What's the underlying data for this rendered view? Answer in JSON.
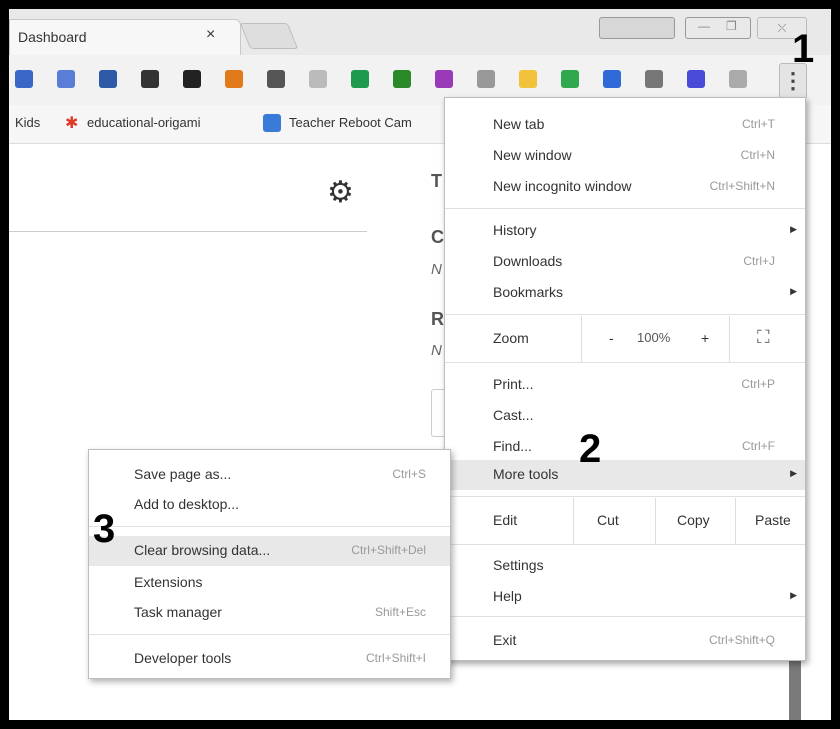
{
  "tab": {
    "title": "Dashboard",
    "close": "×"
  },
  "window": {
    "close": "⛌",
    "min": "—",
    "restore": "❐"
  },
  "toolbar": {
    "menu_icon": "⋮",
    "extensions": [
      "#3a66c8",
      "#5a7dd8",
      "#2f5aa8",
      "#333333",
      "#222222",
      "#e07a1a",
      "#555555",
      "#bbbbbb",
      "#1e9a4e",
      "#2a8a2a",
      "#9a3ab8",
      "#999999",
      "#f2c23a",
      "#2fa84e",
      "#2f6ad8",
      "#777777",
      "#4a4ad8",
      "#aaaaaa"
    ]
  },
  "bookmarks": [
    {
      "label": "Kids",
      "icon": ""
    },
    {
      "label": "educational-origami",
      "icon": "pinwheel-icon"
    },
    {
      "label": "Teacher Reboot Cam",
      "icon": "arrows-icon"
    }
  ],
  "page": {
    "gear_icon": "⚙",
    "letters": [
      "T",
      "C",
      "N",
      "R",
      "N"
    ]
  },
  "menu": {
    "new_tab": {
      "label": "New tab",
      "shortcut": "Ctrl+T"
    },
    "new_window": {
      "label": "New window",
      "shortcut": "Ctrl+N"
    },
    "incognito": {
      "label": "New incognito window",
      "shortcut": "Ctrl+Shift+N"
    },
    "history": {
      "label": "History"
    },
    "downloads": {
      "label": "Downloads",
      "shortcut": "Ctrl+J"
    },
    "bookmarks": {
      "label": "Bookmarks"
    },
    "zoom": {
      "label": "Zoom",
      "minus": "-",
      "level": "100%",
      "plus": "+",
      "fullscreen": "⛶"
    },
    "print": {
      "label": "Print...",
      "shortcut": "Ctrl+P"
    },
    "cast": {
      "label": "Cast..."
    },
    "find": {
      "label": "Find...",
      "shortcut": "Ctrl+F"
    },
    "more_tools": {
      "label": "More tools"
    },
    "edit": {
      "label": "Edit",
      "cut": "Cut",
      "copy": "Copy",
      "paste": "Paste"
    },
    "settings": {
      "label": "Settings"
    },
    "help": {
      "label": "Help"
    },
    "exit": {
      "label": "Exit",
      "shortcut": "Ctrl+Shift+Q"
    },
    "arrow": "▶"
  },
  "submenu": {
    "save_page": {
      "label": "Save page as...",
      "shortcut": "Ctrl+S"
    },
    "add_desktop": {
      "label": "Add to desktop..."
    },
    "clear_data": {
      "label": "Clear browsing data...",
      "shortcut": "Ctrl+Shift+Del"
    },
    "extensions": {
      "label": "Extensions"
    },
    "task_manager": {
      "label": "Task manager",
      "shortcut": "Shift+Esc"
    },
    "dev_tools": {
      "label": "Developer tools",
      "shortcut": "Ctrl+Shift+I"
    }
  },
  "callouts": {
    "one": "1",
    "two": "2",
    "three": "3"
  }
}
